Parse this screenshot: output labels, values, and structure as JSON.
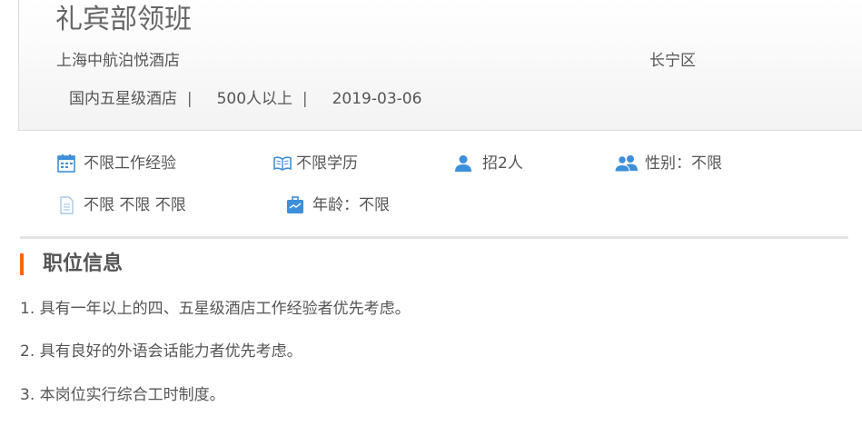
{
  "job": {
    "title": "礼宾部领班",
    "company": "上海中航泊悦酒店",
    "district": "长宁区",
    "meta": {
      "hotel_type": "国内五星级酒店",
      "size": "500人以上",
      "date": "2019-03-06",
      "separator": "|"
    }
  },
  "requirements": [
    {
      "icon": "calendar-icon",
      "label": "不限工作经验"
    },
    {
      "icon": "book-icon",
      "label": "不限学历"
    },
    {
      "icon": "person-icon",
      "label": "招2人"
    },
    {
      "icon": "people-icon",
      "label": "性别：不限"
    },
    {
      "icon": "document-icon",
      "label": "不限 不限 不限"
    },
    {
      "icon": "briefcase-icon",
      "label": "年龄：不限"
    }
  ],
  "section": {
    "title": "职位信息"
  },
  "duties": [
    "1. 具有一年以上的四、五星级酒店工作经验者优先考虑。",
    "2. 具有良好的外语会话能力者优先考虑。",
    "3. 本岗位实行综合工时制度。"
  ],
  "colors": {
    "accent": "#ff6600",
    "icon_blue": "#3d8fd9",
    "text": "#555555"
  }
}
